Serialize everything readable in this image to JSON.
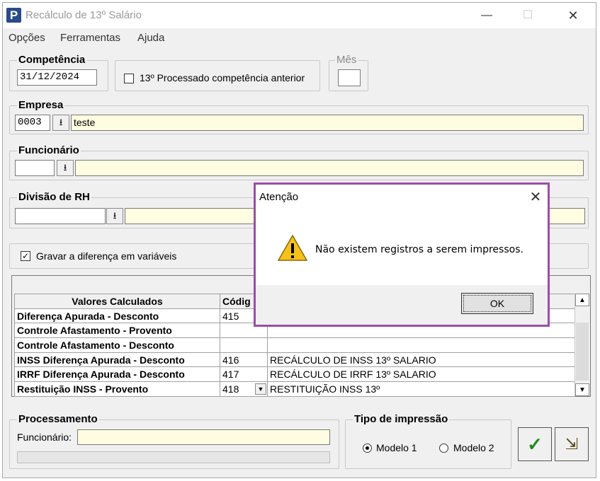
{
  "window": {
    "title": "Recálculo de 13º Salário",
    "minimize": "—",
    "maximize": "☐",
    "close": "✕"
  },
  "menu": [
    "Opções",
    "Ferramentas",
    "Ajuda"
  ],
  "competencia": {
    "label": "Competência",
    "value": "31/12/2024",
    "checkbox_label": "13º Processado competência anterior",
    "checkbox_checked": false
  },
  "mes": {
    "label": "Mês",
    "value": ""
  },
  "empresa": {
    "label": "Empresa",
    "code": "0003",
    "name": "teste"
  },
  "funcionario": {
    "label": "Funcionário",
    "code": "",
    "name": ""
  },
  "divisao": {
    "label": "Divisão de RH",
    "code": "",
    "name": ""
  },
  "gravar": {
    "label": "Gravar a diferença em variáveis",
    "checked": true,
    "check_glyph": "✓"
  },
  "grid": {
    "headers": [
      "Valores Calculados",
      "Códig"
    ],
    "rows": [
      {
        "name": "Diferença Apurada - Desconto",
        "code": "415",
        "desc": ""
      },
      {
        "name": "Controle Afastamento - Provento",
        "code": "",
        "desc": ""
      },
      {
        "name": "Controle Afastamento - Desconto",
        "code": "",
        "desc": ""
      },
      {
        "name": "INSS Diferença Apurada - Desconto",
        "code": "416",
        "desc": "RECÁLCULO DE INSS 13º SALARIO"
      },
      {
        "name": "IRRF Diferença Apurada - Desconto",
        "code": "417",
        "desc": "RECÁLCULO DE IRRF 13º SALARIO"
      },
      {
        "name": "Restituição INSS - Provento",
        "code": "418",
        "desc": "RESTITUIÇÃO INSS 13º"
      }
    ]
  },
  "processamento": {
    "label": "Processamento",
    "funcionario_label": "Funcionário:",
    "funcionario_value": ""
  },
  "tipo_impressao": {
    "label": "Tipo de impressão",
    "options": [
      "Modelo 1",
      "Modelo 2"
    ],
    "selected": "Modelo 1"
  },
  "buttons": {
    "confirm_glyph": "✓",
    "exit_glyph": "⇲"
  },
  "dialog": {
    "title": "Atenção",
    "close": "✕",
    "message": "Não existem registros a serem impressos.",
    "ok_label": "OK"
  },
  "colors": {
    "dialog_border": "#9a4ea8",
    "field_yellow": "#fffde1",
    "confirm_green": "#1e8a1e"
  }
}
